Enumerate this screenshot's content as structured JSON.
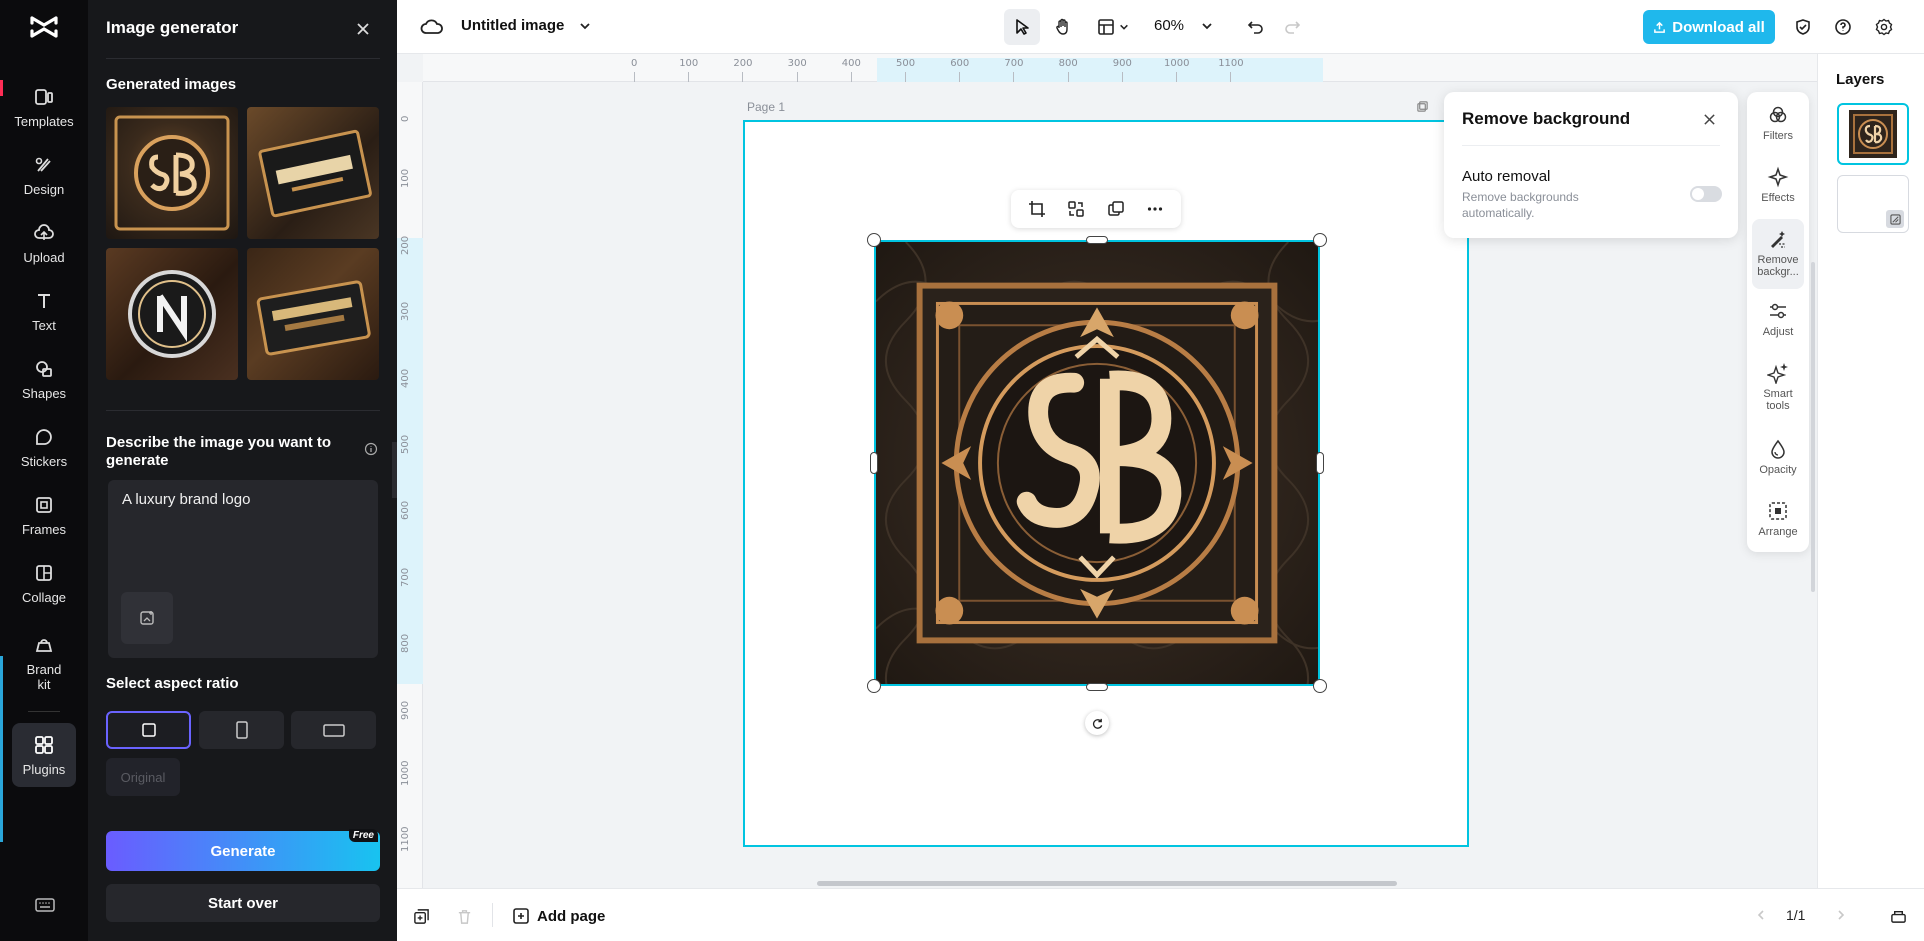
{
  "rail": {
    "items": [
      {
        "label": "Templates",
        "icon": "templates-icon"
      },
      {
        "label": "Design",
        "icon": "design-icon"
      },
      {
        "label": "Upload",
        "icon": "upload-icon"
      },
      {
        "label": "Text",
        "icon": "text-icon"
      },
      {
        "label": "Shapes",
        "icon": "shapes-icon"
      },
      {
        "label": "Stickers",
        "icon": "stickers-icon"
      },
      {
        "label": "Frames",
        "icon": "frames-icon"
      },
      {
        "label": "Collage",
        "icon": "collage-icon"
      },
      {
        "label": "Brand kit",
        "icon": "brand-kit-icon"
      },
      {
        "label": "Plugins",
        "icon": "plugins-icon"
      }
    ]
  },
  "panel": {
    "title": "Image generator",
    "generated_label": "Generated images",
    "prompt_label": "Describe the image you want to generate",
    "prompt_value": "A luxury brand logo",
    "aspect_label": "Select aspect ratio",
    "original_label": "Original",
    "generate_label": "Generate",
    "free_badge": "Free",
    "start_over_label": "Start over"
  },
  "topbar": {
    "title": "Untitled image",
    "zoom": "60%",
    "download_label": "Download all"
  },
  "canvas": {
    "page_label": "Page 1",
    "ruler_x": [
      "0",
      "100",
      "200",
      "300",
      "400",
      "500",
      "600",
      "700",
      "800",
      "900",
      "1000",
      "1100"
    ],
    "ruler_y": [
      "0",
      "100",
      "200",
      "300",
      "400",
      "500",
      "600",
      "700",
      "800",
      "900",
      "1000",
      "1100"
    ]
  },
  "remove_bg": {
    "title": "Remove background",
    "option_label": "Auto removal",
    "option_desc": "Remove backgrounds automatically.",
    "enabled": false
  },
  "tools": [
    {
      "label": "Filters",
      "icon": "filters-icon"
    },
    {
      "label": "Effects",
      "icon": "effects-icon"
    },
    {
      "label": "Remove backgr...",
      "icon": "remove-background-icon"
    },
    {
      "label": "Adjust",
      "icon": "adjust-icon"
    },
    {
      "label": "Smart tools",
      "icon": "smart-tools-icon"
    },
    {
      "label": "Opacity",
      "icon": "opacity-icon"
    },
    {
      "label": "Arrange",
      "icon": "arrange-icon"
    }
  ],
  "layers": {
    "title": "Layers"
  },
  "bottombar": {
    "add_page_label": "Add page",
    "page_count": "1/1"
  },
  "colors": {
    "accent": "#1fb8ec",
    "selection": "#00c4e0",
    "panel": "#17181b",
    "generate_from": "#6a5cff",
    "generate_to": "#18c3f0"
  }
}
